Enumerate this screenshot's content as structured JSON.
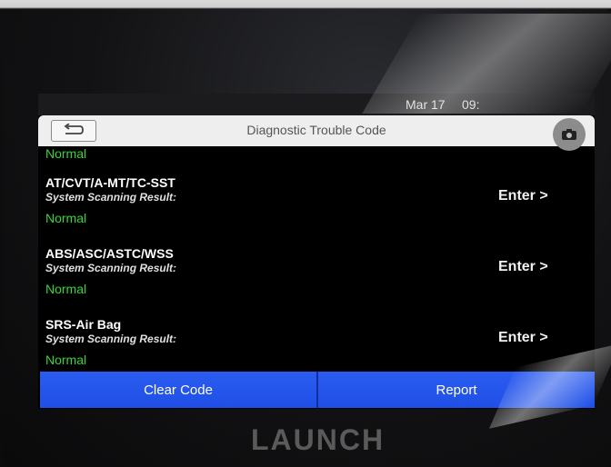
{
  "status_bar": {
    "date": "Mar 17",
    "time": "09:"
  },
  "header": {
    "title": "Diagnostic Trouble Code"
  },
  "top_item": {
    "status": "Normal"
  },
  "systems": [
    {
      "name": "AT/CVT/A-MT/TC-SST",
      "result_label": "System Scanning Result:",
      "status": "Normal",
      "enter": "Enter >"
    },
    {
      "name": "ABS/ASC/ASTC/WSS",
      "result_label": "System Scanning Result:",
      "status": "Normal",
      "enter": "Enter >"
    },
    {
      "name": "SRS-Air Bag",
      "result_label": "System Scanning Result:",
      "status": "Normal",
      "enter": "Enter >"
    }
  ],
  "bottom": {
    "clear_code": "Clear Code",
    "report": "Report"
  },
  "device": {
    "logo": "LAUNCH"
  },
  "colors": {
    "normal_green": "#38d438",
    "button_blue": "#2356ea"
  }
}
